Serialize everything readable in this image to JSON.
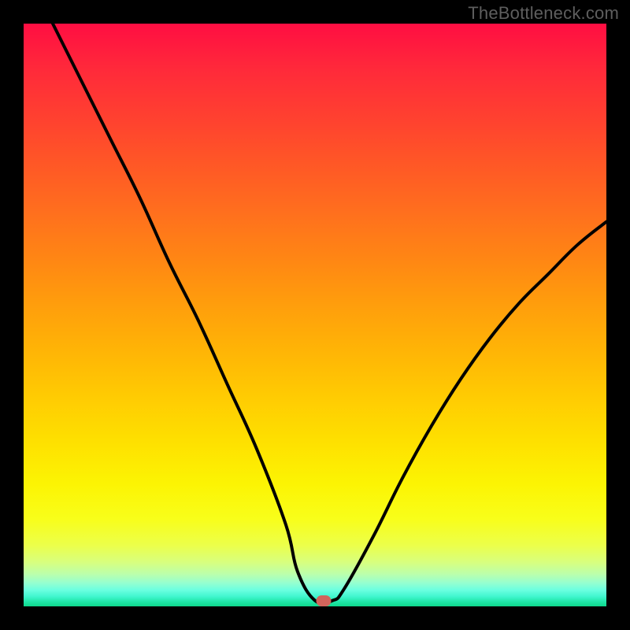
{
  "watermark": "TheBottleneck.com",
  "marker": {
    "x_pct": 51.5,
    "y_pct": 99.0
  },
  "colors": {
    "frame": "#000000",
    "marker": "#d2645b",
    "curve": "#000000"
  },
  "chart_data": {
    "type": "line",
    "title": "",
    "xlabel": "",
    "ylabel": "",
    "xlim": [
      0,
      100
    ],
    "ylim": [
      0,
      100
    ],
    "series": [
      {
        "name": "bottleneck-curve",
        "x": [
          5,
          10,
          15,
          20,
          25,
          30,
          35,
          40,
          45,
          47,
          50,
          53,
          55,
          60,
          65,
          70,
          75,
          80,
          85,
          90,
          95,
          100
        ],
        "y": [
          100,
          90,
          80,
          70,
          59,
          49,
          38,
          27,
          14,
          6,
          1,
          1,
          3,
          12,
          22,
          31,
          39,
          46,
          52,
          57,
          62,
          66
        ]
      }
    ],
    "annotations": [
      {
        "type": "point",
        "x": 51.5,
        "y": 1.0,
        "style": "rounded-rect",
        "color": "#d2645b"
      }
    ],
    "background": "vertical-gradient red→yellow→green"
  }
}
